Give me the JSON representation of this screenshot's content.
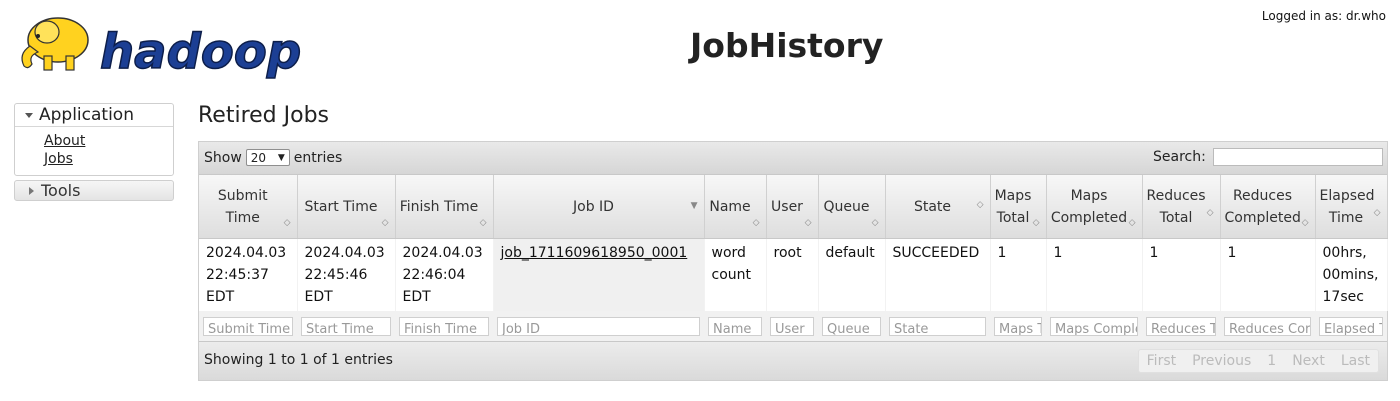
{
  "header": {
    "logo_text": "hadoop",
    "title": "JobHistory",
    "login": "Logged in as: dr.who"
  },
  "sidebar": {
    "application_label": "Application",
    "links": [
      "About",
      "Jobs"
    ],
    "tools_label": "Tools"
  },
  "main": {
    "section_title": "Retired Jobs",
    "show_label": "Show",
    "page_size": "20",
    "entries_label": "entries",
    "search_label": "Search:",
    "columns": [
      "Submit Time",
      "Start Time",
      "Finish Time",
      "Job ID",
      "Name",
      "User",
      "Queue",
      "State",
      "Maps Total",
      "Maps Completed",
      "Reduces Total",
      "Reduces Completed",
      "Elapsed Time"
    ],
    "rows": [
      {
        "submit_time": "2024.04.03 22:45:37 EDT",
        "start_time": "2024.04.03 22:45:46 EDT",
        "finish_time": "2024.04.03 22:46:04 EDT",
        "job_id": "job_1711609618950_0001",
        "name": "word count",
        "user": "root",
        "queue": "default",
        "state": "SUCCEEDED",
        "maps_total": "1",
        "maps_completed": "1",
        "reduces_total": "1",
        "reduces_completed": "1",
        "elapsed": "00hrs, 00mins, 17sec"
      }
    ],
    "filter_placeholders": [
      "Submit Time",
      "Start Time",
      "Finish Time",
      "Job ID",
      "Name",
      "User",
      "Queue",
      "State",
      "Maps T",
      "Maps Comple",
      "Reduces T",
      "Reduces Cor",
      "Elapsed T"
    ],
    "footer_info": "Showing 1 to 1 of 1 entries",
    "pager": {
      "first": "First",
      "previous": "Previous",
      "page": "1",
      "next": "Next",
      "last": "Last"
    }
  },
  "colors": {
    "logo_blue": "#1c3f94",
    "logo_yellow": "#ffd21f",
    "header_gradient_top": "#f7f7f7",
    "header_gradient_bottom": "#dedede"
  }
}
